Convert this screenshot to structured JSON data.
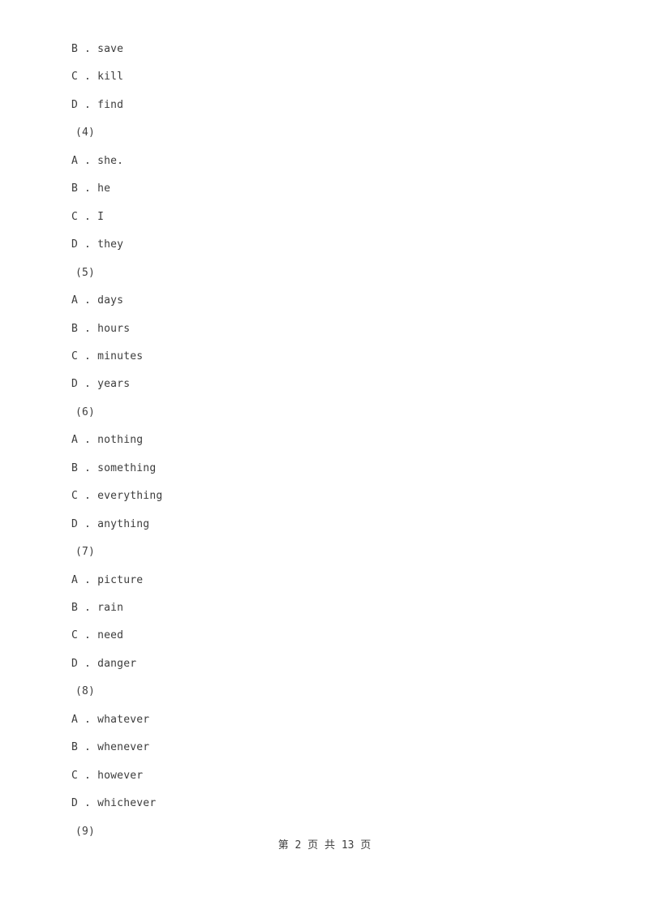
{
  "document": {
    "type": "exam-paper",
    "background_color": "#ffffff",
    "text_color": "#3c3c3c"
  },
  "body_lines": [
    {
      "kind": "option",
      "text": "B . save"
    },
    {
      "kind": "option",
      "text": "C . kill"
    },
    {
      "kind": "option",
      "text": "D . find"
    },
    {
      "kind": "question",
      "text": "(4)"
    },
    {
      "kind": "option",
      "text": "A . she."
    },
    {
      "kind": "option",
      "text": "B . he"
    },
    {
      "kind": "option",
      "text": "C . I"
    },
    {
      "kind": "option",
      "text": "D . they"
    },
    {
      "kind": "question",
      "text": "(5)"
    },
    {
      "kind": "option",
      "text": "A . days"
    },
    {
      "kind": "option",
      "text": "B . hours"
    },
    {
      "kind": "option",
      "text": "C . minutes"
    },
    {
      "kind": "option",
      "text": "D . years"
    },
    {
      "kind": "question",
      "text": "(6)"
    },
    {
      "kind": "option",
      "text": "A . nothing"
    },
    {
      "kind": "option",
      "text": "B . something"
    },
    {
      "kind": "option",
      "text": "C . everything"
    },
    {
      "kind": "option",
      "text": "D . anything"
    },
    {
      "kind": "question",
      "text": "(7)"
    },
    {
      "kind": "option",
      "text": "A . picture"
    },
    {
      "kind": "option",
      "text": "B . rain"
    },
    {
      "kind": "option",
      "text": "C . need"
    },
    {
      "kind": "option",
      "text": "D . danger"
    },
    {
      "kind": "question",
      "text": "(8)"
    },
    {
      "kind": "option",
      "text": "A . whatever"
    },
    {
      "kind": "option",
      "text": "B . whenever"
    },
    {
      "kind": "option",
      "text": "C . however"
    },
    {
      "kind": "option",
      "text": "D . whichever"
    },
    {
      "kind": "question",
      "text": "(9)"
    }
  ],
  "footer": {
    "text": "第 2 页 共 13 页",
    "page_number": "2",
    "total_pages": "13"
  }
}
